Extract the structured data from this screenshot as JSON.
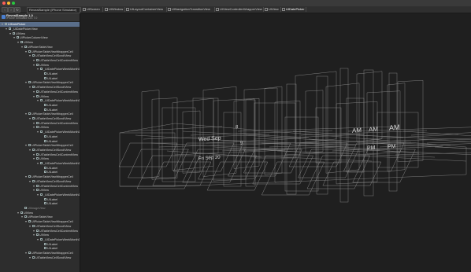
{
  "window": {
    "traffic_lights": {
      "close": "#ff5f57",
      "minimize": "#febc2e",
      "zoom": "#28c840"
    }
  },
  "toolbar": {
    "scheme": "RevealSample (iPhone Simulator)",
    "breadcrumbs": [
      "UIScreen",
      "UIWindow",
      "UILayoutContainerView",
      "UINavigationTransitionView",
      "UIViewControllerWrapperView",
      "UIView",
      "UIDatePicker"
    ],
    "zoom": "13%"
  },
  "sidebar": {
    "app_name": "RevealSample 1.0",
    "app_sub": "iPhone Simulator iOS 7.0",
    "selected": "UIDatePicker",
    "tree": [
      {
        "label": "_UIDatePickerView",
        "depth": 1
      },
      {
        "label": "UIView",
        "depth": 2
      },
      {
        "label": "UIPickerColumnView",
        "depth": 3
      },
      {
        "label": "UIView",
        "depth": 4
      },
      {
        "label": "UIPickerTableView",
        "depth": 5
      },
      {
        "label": "UIPickerTableViewWrapperCell",
        "depth": 6
      },
      {
        "label": "UITableViewCellScrollView",
        "depth": 7
      },
      {
        "label": "UITableViewCellContentView",
        "depth": 8
      },
      {
        "label": "UIView",
        "depth": 8
      },
      {
        "label": "_UIDatePickerWeekMonthD",
        "depth": 9
      },
      {
        "label": "UILabel",
        "depth": 10
      },
      {
        "label": "UILabel",
        "depth": 10
      },
      {
        "label": "UIPickerTableViewWrapperCell",
        "depth": 6
      },
      {
        "label": "UITableViewCellScrollView",
        "depth": 7
      },
      {
        "label": "UITableViewCellContentView",
        "depth": 8
      },
      {
        "label": "UIView",
        "depth": 8
      },
      {
        "label": "_UIDatePickerWeekMonthD",
        "depth": 9
      },
      {
        "label": "UILabel",
        "depth": 10
      },
      {
        "label": "UILabel",
        "depth": 10
      },
      {
        "label": "UIPickerTableViewWrapperCell",
        "depth": 6
      },
      {
        "label": "UITableViewCellScrollView",
        "depth": 7
      },
      {
        "label": "UITableViewCellContentView",
        "depth": 8
      },
      {
        "label": "UIView",
        "depth": 8
      },
      {
        "label": "_UIDatePickerWeekMonthD",
        "depth": 9
      },
      {
        "label": "UILabel",
        "depth": 10
      },
      {
        "label": "UILabel",
        "depth": 10
      },
      {
        "label": "UIPickerTableViewWrapperCell",
        "depth": 6
      },
      {
        "label": "UITableViewCellScrollView",
        "depth": 7
      },
      {
        "label": "UITableViewCellContentView",
        "depth": 8
      },
      {
        "label": "UIView",
        "depth": 8
      },
      {
        "label": "_UIDatePickerWeekMonthD",
        "depth": 9
      },
      {
        "label": "UILabel",
        "depth": 10
      },
      {
        "label": "UILabel",
        "depth": 10
      },
      {
        "label": "UIPickerTableViewWrapperCell",
        "depth": 6
      },
      {
        "label": "UITableViewCellScrollView",
        "depth": 7
      },
      {
        "label": "UITableViewCellContentView",
        "depth": 8
      },
      {
        "label": "UIView",
        "depth": 8
      },
      {
        "label": "_UIDatePickerWeekMonthD",
        "depth": 9
      },
      {
        "label": "UILabel",
        "depth": 10
      },
      {
        "label": "UILabel",
        "depth": 10
      },
      {
        "label": "UIImageView",
        "depth": 5,
        "dim": true
      },
      {
        "label": "UIView",
        "depth": 4
      },
      {
        "label": "UIPickerTableView",
        "depth": 5
      },
      {
        "label": "UIPickerTableViewWrapperCell",
        "depth": 6
      },
      {
        "label": "UITableViewCellScrollView",
        "depth": 7
      },
      {
        "label": "UITableViewCellContentView",
        "depth": 8
      },
      {
        "label": "UIView",
        "depth": 8
      },
      {
        "label": "_UIDatePickerWeekMonthD",
        "depth": 9
      },
      {
        "label": "UILabel",
        "depth": 10
      },
      {
        "label": "UILabel",
        "depth": 10
      },
      {
        "label": "UIPickerTableViewWrapperCell",
        "depth": 6
      },
      {
        "label": "UITableViewCellScrollView",
        "depth": 7
      }
    ]
  },
  "scene": {
    "labels": [
      "Wed Sep",
      "Fri Sep 20",
      "8",
      "9",
      "AM",
      "AM",
      "AM",
      "PM",
      "PM"
    ]
  }
}
